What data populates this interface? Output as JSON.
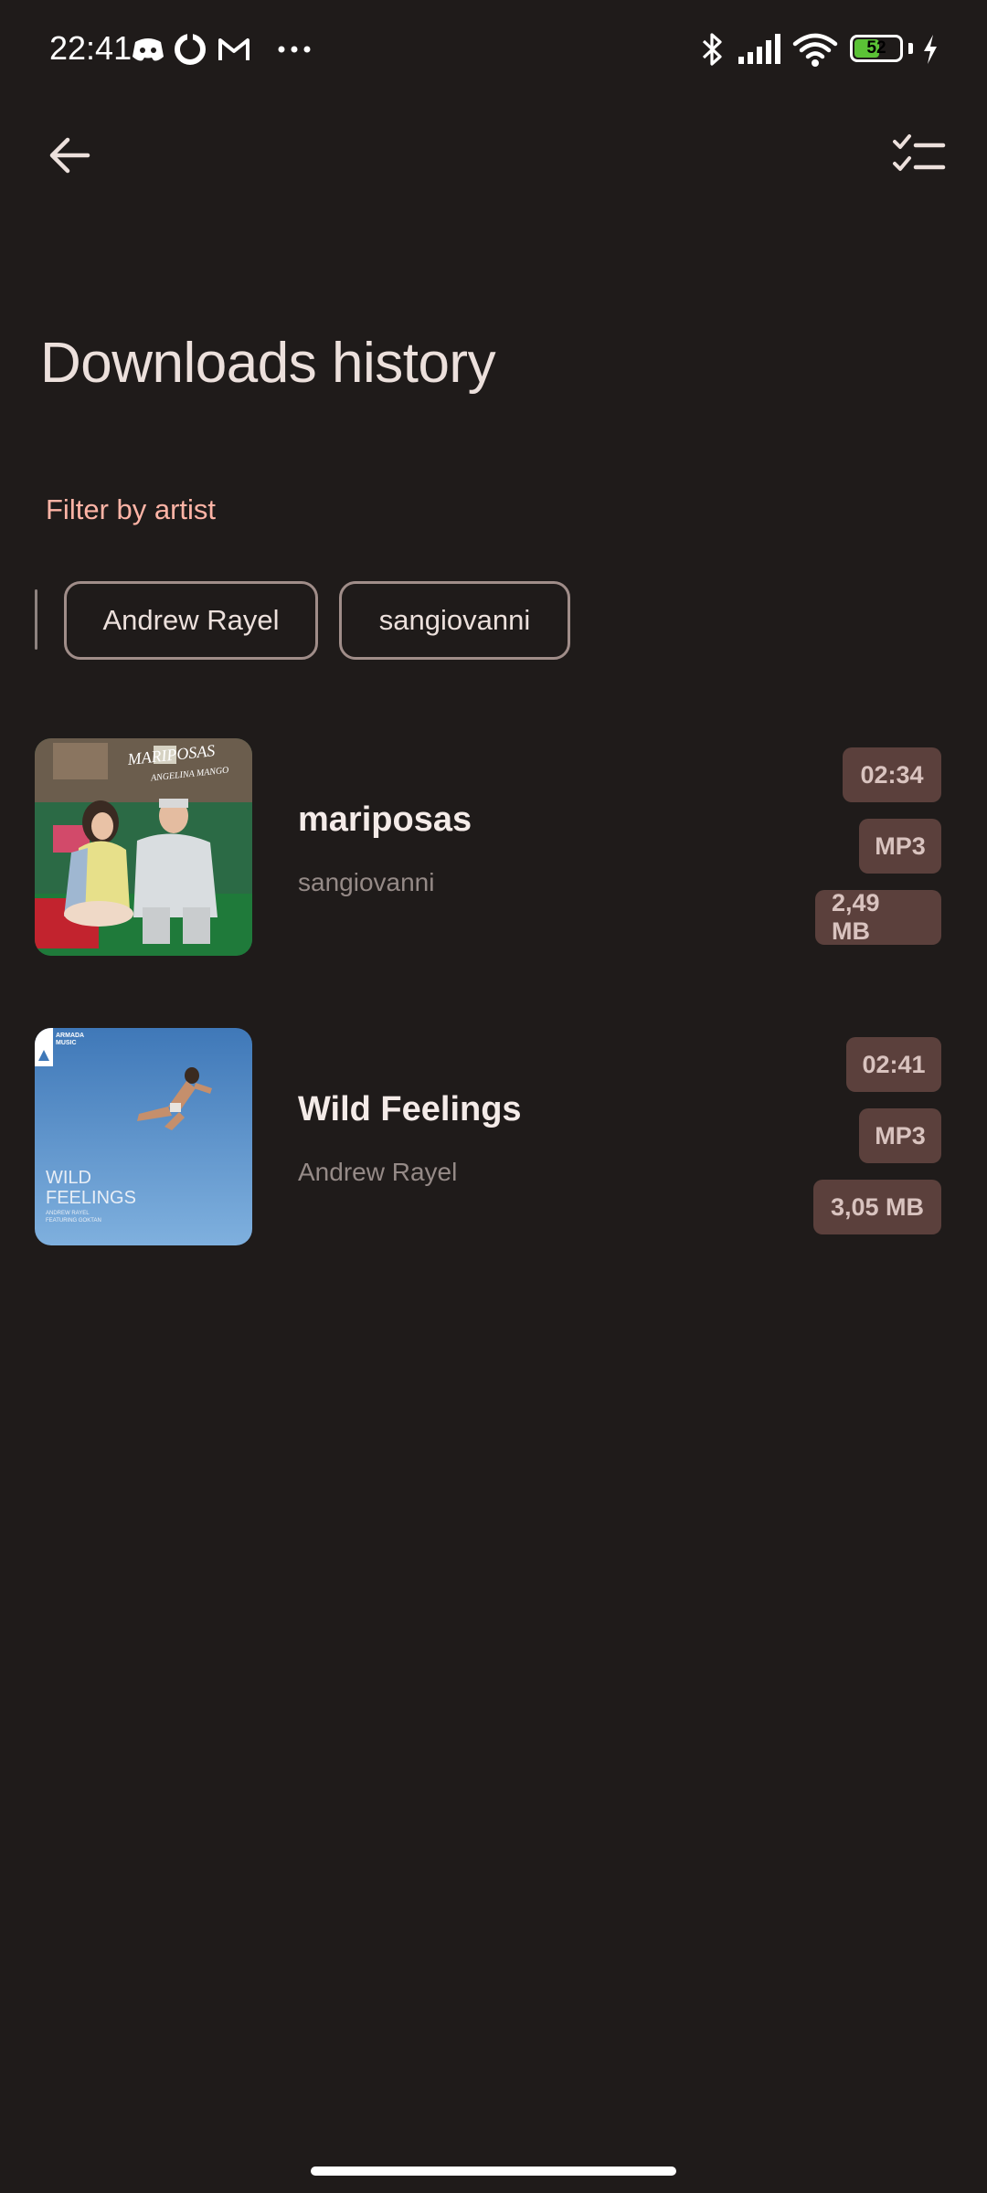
{
  "status_bar": {
    "time": "22:41",
    "battery_level": "52",
    "battery_fraction": 0.52,
    "notification_icons": [
      "discord-icon",
      "circle-app-icon",
      "gmail-icon",
      "more-dots-icon"
    ],
    "system_icons": [
      "bluetooth-icon",
      "signal-icon",
      "wifi-icon",
      "battery-icon",
      "charging-icon"
    ]
  },
  "app_bar": {
    "back_icon": "arrow-left-icon",
    "action_icon": "checklist-icon"
  },
  "page": {
    "title": "Downloads history",
    "filter_label": "Filter by artist"
  },
  "filters": {
    "chips": [
      {
        "label": "Andrew Rayel"
      },
      {
        "label": "sangiovanni"
      }
    ]
  },
  "songs": [
    {
      "title": "mariposas",
      "artist": "sangiovanni",
      "duration": "02:34",
      "format": "MP3",
      "size": "2,49 MB",
      "cover": {
        "heading": "MARIPOSAS",
        "subheading": "ANGELINA MANGO"
      }
    },
    {
      "title": "Wild Feelings",
      "artist": "Andrew Rayel",
      "duration": "02:41",
      "format": "MP3",
      "size": "3,05 MB",
      "cover": {
        "label_line1": "ARMADA",
        "label_line2": "MUSIC",
        "title_line1": "WILD",
        "title_line2": "FEELINGS",
        "credit_line1": "ANDREW RAYEL",
        "credit_line2": "FEATURING GOKTAN"
      }
    }
  ],
  "colors": {
    "background": "#1f1b1a",
    "accent": "#ffb4a6",
    "badge_bg": "#5b403c",
    "chip_border": "#a08d89"
  }
}
